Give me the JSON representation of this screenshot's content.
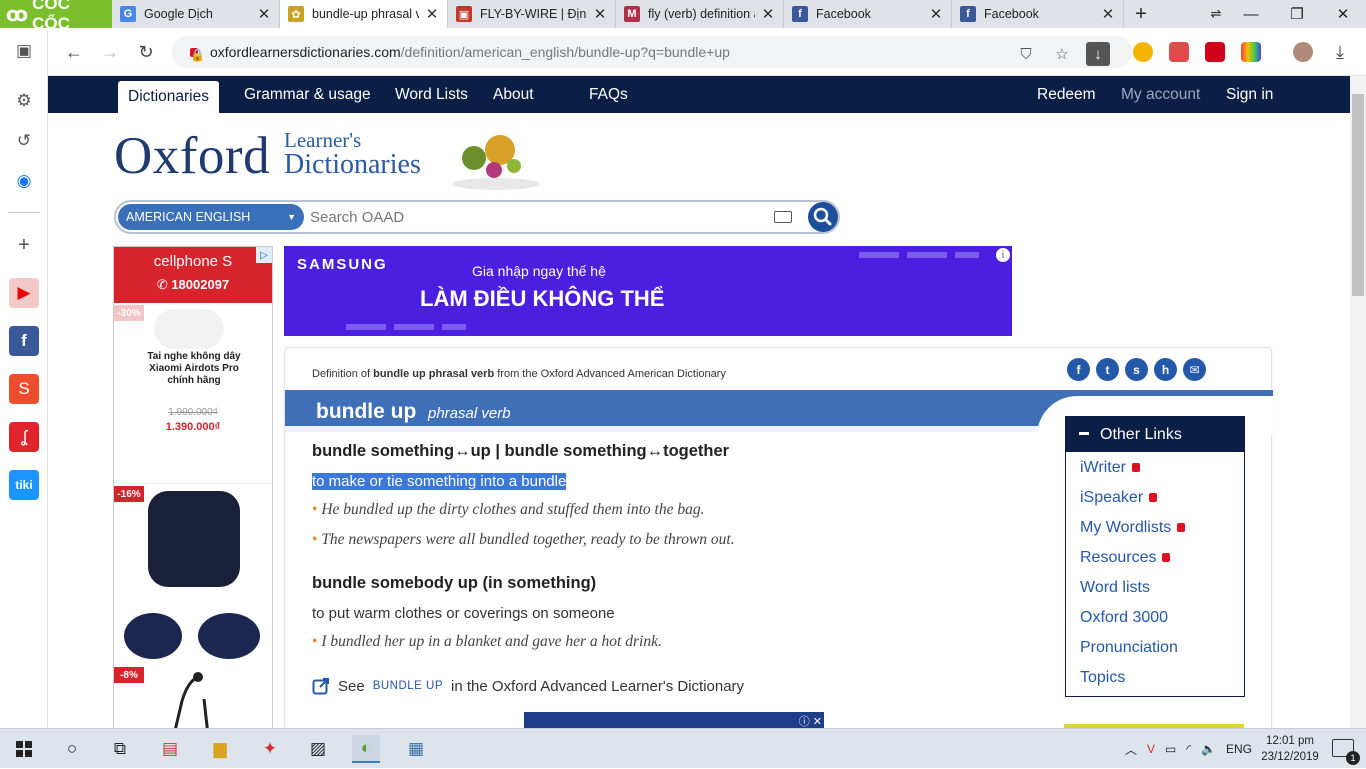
{
  "browser": {
    "brand": "CỐC CỐC",
    "tabs": [
      {
        "title": "Google Dịch",
        "favicon": "google-translate-icon",
        "color": "#4a86e8",
        "active": false
      },
      {
        "title": "bundle-up phrasal ve",
        "favicon": "oxford-favicon",
        "color": "#c9a227",
        "active": true
      },
      {
        "title": "FLY-BY-WIRE | Định n",
        "favicon": "cambridge-favicon",
        "color": "#c0392b",
        "active": false
      },
      {
        "title": "fly (verb) definition a",
        "favicon": "merriam-favicon",
        "color": "#b0304a",
        "active": false
      },
      {
        "title": "Facebook",
        "favicon": "facebook-icon",
        "color": "#3b5998",
        "active": false
      },
      {
        "title": "Facebook",
        "favicon": "facebook-icon",
        "color": "#3b5998",
        "active": false
      }
    ],
    "url_host": "oxfordlearnersdictionaries.com",
    "url_path": "/definition/american_english/bundle-up?q=bundle+up"
  },
  "nav": {
    "items": [
      "Dictionaries",
      "Grammar & usage",
      "Word Lists",
      "About",
      "FAQs"
    ],
    "right": [
      "Redeem",
      "My account",
      "Sign in"
    ]
  },
  "logo": {
    "oxford": "Oxford",
    "learners": "Learner's",
    "dictionaries": "Dictionaries"
  },
  "search": {
    "dictionary": "AMERICAN ENGLISH",
    "placeholder": "Search OAAD"
  },
  "left_ad": {
    "brand": "cellphone S",
    "phone": "✆ 18002097",
    "product1_discount": "-30%",
    "product1_name": "Tai nghe không dây Xiaomi Airdots Pro chính hãng",
    "old_price": "1.990.000₫",
    "new_price": "1.390.000₫",
    "product2_discount": "-16%",
    "product3_discount": "-8%"
  },
  "samsung_ad": {
    "logo": "SAMSUNG",
    "line1": "Gia nhập ngay thế hệ",
    "line2": "LÀM ĐIỀU KHÔNG THỂ"
  },
  "entry": {
    "origin_prefix": "Definition of ",
    "origin_word": "bundle up phrasal verb",
    "origin_suffix": " from the Oxford Advanced American Dictionary",
    "headword": "bundle up",
    "pos": "phrasal verb",
    "sense1_phrase": "bundle something↔up | bundle something↔together",
    "sense1_def": "to make or tie something into a bundle",
    "sense1_examples": [
      "He bundled up the dirty clothes and stuffed them into the bag.",
      "The newspapers were all bundled together, ready to be thrown out."
    ],
    "sense2_phrase": "bundle somebody up (in something)",
    "sense2_def": "to put warm clothes or coverings on someone",
    "sense2_examples": [
      "I bundled her up in a blanket and gave her a hot drink."
    ],
    "see_prefix": "See",
    "see_link": "BUNDLE UP",
    "see_suffix": "in the Oxford Advanced Learner's Dictionary"
  },
  "other_links": {
    "title": "Other Links",
    "items": [
      {
        "label": "iWriter",
        "locked": true
      },
      {
        "label": "iSpeaker",
        "locked": true
      },
      {
        "label": "My Wordlists",
        "locked": true
      },
      {
        "label": "Resources",
        "locked": true
      },
      {
        "label": "Word lists",
        "locked": false
      },
      {
        "label": "Oxford 3000",
        "locked": false
      },
      {
        "label": "Pronunciation",
        "locked": false
      },
      {
        "label": "Topics",
        "locked": false
      }
    ]
  },
  "taskbar": {
    "lang": "ENG",
    "time": "12:01 pm",
    "date": "23/12/2019",
    "notifications": "1"
  },
  "colors": {
    "nav": "#0a1e46",
    "header": "#3f6fb7",
    "highlight": "#3c78d8",
    "link": "#2458a8",
    "bullet": "#e08a2e"
  }
}
